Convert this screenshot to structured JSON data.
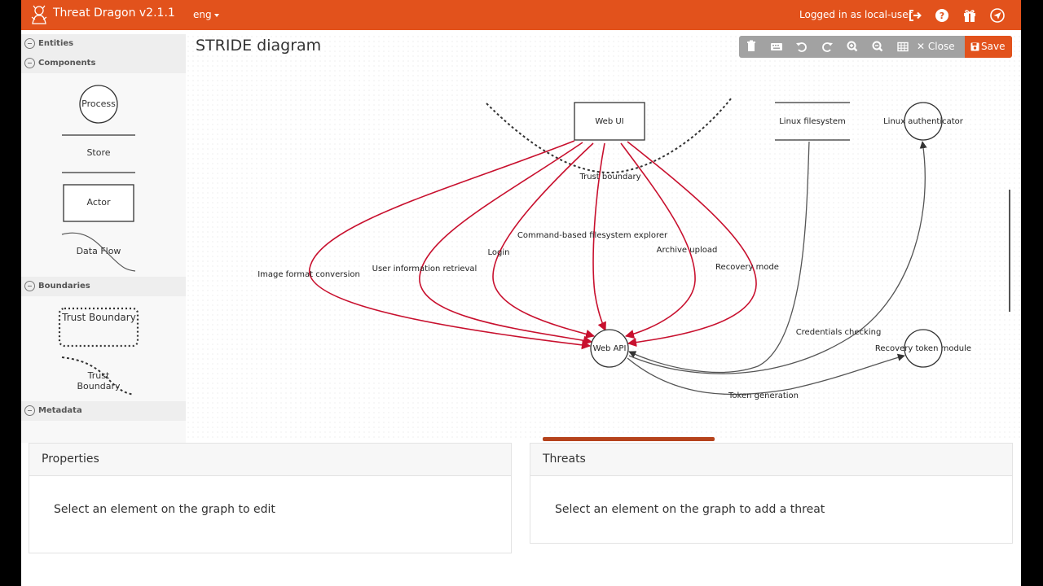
{
  "app": {
    "title": "Threat Dragon v2.1.1",
    "language": "eng",
    "user_status": "Logged in as local-user",
    "accent_color": "#e2521c"
  },
  "nav_icons": [
    "sign-out-icon",
    "help-icon",
    "gift-icon",
    "send-icon"
  ],
  "sidebar": {
    "groups": {
      "entities": "Entities",
      "components": "Components",
      "boundaries": "Boundaries",
      "metadata": "Metadata"
    },
    "shapes": {
      "process": "Process",
      "store": "Store",
      "actor": "Actor",
      "data_flow": "Data Flow",
      "trust_boundary_box": "Trust Boundary",
      "trust_boundary_curve": "Trust Boundary"
    }
  },
  "diagram": {
    "title": "STRIDE diagram",
    "nodes": {
      "web_ui": "Web UI",
      "linux_fs": "Linux filesystem",
      "linux_auth": "Linux authenticator",
      "web_api": "Web API",
      "recovery_token": "Recovery token module"
    },
    "boundary_label": "Trust boundary",
    "flows": {
      "image_format": "Image format conversion",
      "user_info": "User information retrieval",
      "login": "Login",
      "command_fs": "Command-based filesystem explorer",
      "archive_upload": "Archive upload",
      "recovery_mode": "Recovery mode",
      "credentials": "Credentials checking",
      "token_gen": "Token generation"
    },
    "flow_color_red": "#c8102e",
    "flow_color_grey": "#555555"
  },
  "toolbar": {
    "icons": [
      "trash-icon",
      "keyboard-icon",
      "undo-icon",
      "redo-icon",
      "zoom-in-icon",
      "zoom-out-icon",
      "grid-icon"
    ],
    "close_label": "Close",
    "save_label": "Save"
  },
  "properties_panel": {
    "title": "Properties",
    "empty_text": "Select an element on the graph to edit"
  },
  "threats_panel": {
    "title": "Threats",
    "empty_text": "Select an element on the graph to add a threat"
  }
}
